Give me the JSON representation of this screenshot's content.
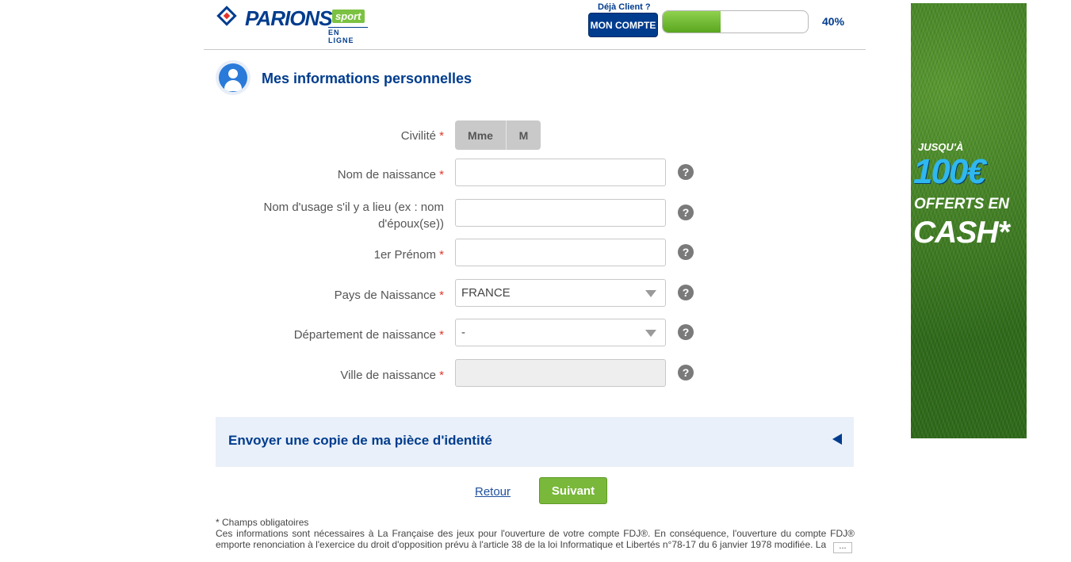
{
  "header": {
    "brand": "PARIONS",
    "brand_badge": "sport",
    "brand_sub": "EN LIGNE",
    "deja_client": "Déjà Client ?",
    "account_button": "MON COMPTE",
    "progress_percent": 40,
    "progress_label": "40%"
  },
  "section": {
    "title": "Mes informations personnelles"
  },
  "form": {
    "civilite_label": "Civilité",
    "civilite_options": [
      "Mme",
      "M"
    ],
    "nom_naissance_label": "Nom de naissance",
    "nom_naissance_value": "",
    "nom_usage_label_line1": "Nom d'usage s'il y a lieu (ex : nom",
    "nom_usage_label_line2": "d'époux(se))",
    "nom_usage_value": "",
    "prenom_label": "1er Prénom",
    "prenom_value": "",
    "pays_label": "Pays de Naissance",
    "pays_value": "FRANCE",
    "departement_label": "Département de naissance",
    "departement_value": "-",
    "ville_label": "Ville de naissance",
    "ville_value": "",
    "required_mark": "*",
    "help_glyph": "?"
  },
  "panel": {
    "title": "Envoyer une copie de ma pièce d'identité"
  },
  "actions": {
    "back": "Retour",
    "next": "Suivant"
  },
  "footer": {
    "required_note": "* Champs obligatoires",
    "legal": "Ces informations sont nécessaires à La Française des jeux pour l'ouverture de votre compte FDJ®. En conséquence, l'ouverture du compte FDJ® emporte renonciation à l'exercice du droit d'opposition prévu à l'article 38 de la loi Informatique et Libertés n°78-17 du 6 janvier 1978 modifiée. La",
    "more": "..."
  },
  "ad": {
    "line1": "JUSQU'À",
    "line2": "100€",
    "line3": "OFFERTS EN",
    "line4": "CASH*"
  },
  "colors": {
    "brand_blue": "#003c8e",
    "accent_green": "#79b83a",
    "required_red": "#e5332a"
  }
}
